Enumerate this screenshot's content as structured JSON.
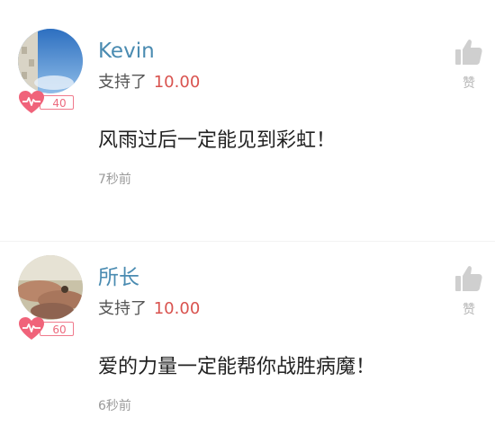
{
  "comments": [
    {
      "username": "Kevin",
      "support_text": "支持了",
      "support_amount": "10.00",
      "level": "40",
      "content": "风雨过后一定能见到彩虹！",
      "timestamp": "7秒前",
      "like_label": "赞",
      "avatar_icon": "sky-photo-avatar",
      "like_icon": "thumbs-up-icon"
    },
    {
      "username": "所长",
      "support_text": "支持了",
      "support_amount": "10.00",
      "level": "60",
      "content": "爱的力量一定能帮你战胜病魔！",
      "timestamp": "6秒前",
      "like_label": "赞",
      "avatar_icon": "hands-photo-avatar",
      "like_icon": "thumbs-up-icon"
    }
  ],
  "colors": {
    "username": "#4a8bb1",
    "amount": "#d9534f",
    "level_badge": "#ec6a7e",
    "muted": "#9a9a9a"
  }
}
